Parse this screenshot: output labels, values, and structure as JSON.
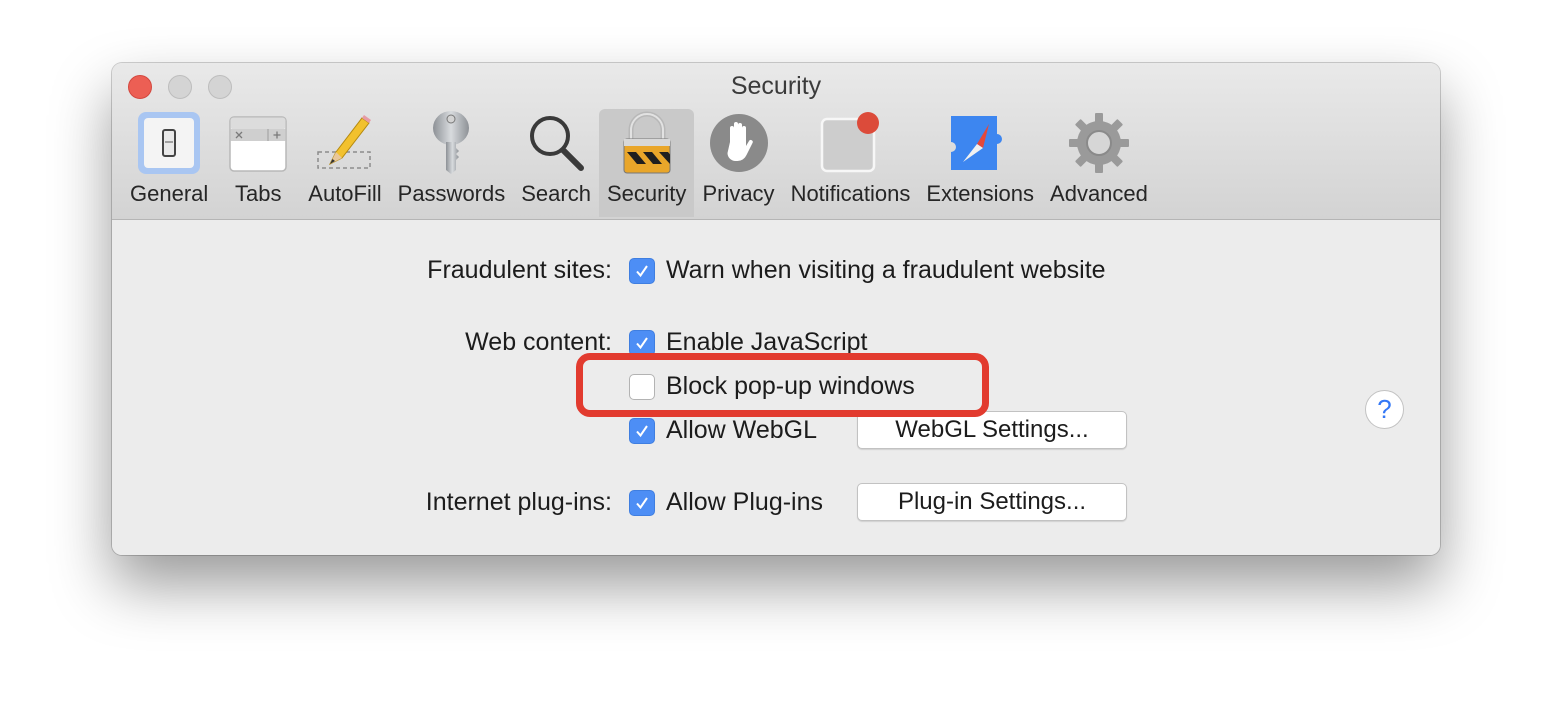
{
  "window": {
    "title": "Security",
    "traffic_lights": {
      "close": "#ec5f54",
      "minimize": "#d4d4d4",
      "maximize": "#d4d4d4"
    }
  },
  "toolbar": {
    "items": [
      {
        "label": "General",
        "icon": "general-switch-icon",
        "selected": false
      },
      {
        "label": "Tabs",
        "icon": "tabs-icon",
        "selected": false
      },
      {
        "label": "AutoFill",
        "icon": "pencil-icon",
        "selected": false
      },
      {
        "label": "Passwords",
        "icon": "key-icon",
        "selected": false
      },
      {
        "label": "Search",
        "icon": "magnifier-icon",
        "selected": false
      },
      {
        "label": "Security",
        "icon": "padlock-icon",
        "selected": true
      },
      {
        "label": "Privacy",
        "icon": "hand-icon",
        "selected": false
      },
      {
        "label": "Notifications",
        "icon": "notification-badge-icon",
        "selected": false
      },
      {
        "label": "Extensions",
        "icon": "compass-puzzle-icon",
        "selected": false
      },
      {
        "label": "Advanced",
        "icon": "gear-icon",
        "selected": false
      }
    ]
  },
  "settings": {
    "fraudulent": {
      "label": "Fraudulent sites:",
      "warn": {
        "text": "Warn when visiting a fraudulent website",
        "checked": true
      }
    },
    "web_content": {
      "label": "Web content:",
      "javascript": {
        "text": "Enable JavaScript",
        "checked": true
      },
      "popups": {
        "text": "Block pop-up windows",
        "checked": false
      },
      "webgl": {
        "text": "Allow WebGL",
        "checked": true,
        "button": "WebGL Settings..."
      }
    },
    "plugins": {
      "label": "Internet plug-ins:",
      "allow": {
        "text": "Allow Plug-ins",
        "checked": true,
        "button": "Plug-in Settings..."
      }
    }
  },
  "help": {
    "symbol": "?"
  },
  "annotation": {
    "color": "#e23b2f",
    "target": "Block pop-up windows"
  },
  "colors": {
    "checkbox_accent": "#4d8ef5",
    "help_accent": "#3478f6"
  }
}
